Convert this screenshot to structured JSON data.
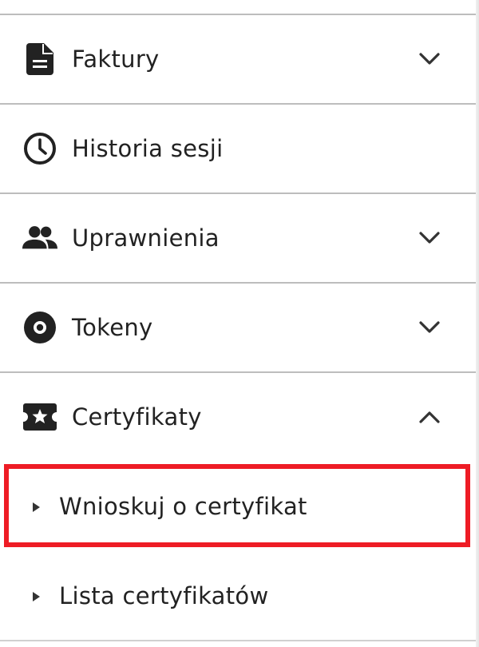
{
  "menu": {
    "items": [
      {
        "label": "Faktury",
        "icon": "document-icon",
        "chevron": "chevron-down-icon"
      },
      {
        "label": "Historia sesji",
        "icon": "clock-icon",
        "chevron": ""
      },
      {
        "label": "Uprawnienia",
        "icon": "people-icon",
        "chevron": "chevron-down-icon"
      },
      {
        "label": "Tokeny",
        "icon": "token-disc-icon",
        "chevron": "chevron-down-icon"
      },
      {
        "label": "Certyfikaty",
        "icon": "certificate-star-icon",
        "chevron": "chevron-up-icon"
      }
    ],
    "certyfikaty_submenu": [
      {
        "label": "Wnioskuj o certyfikat",
        "icon": "triangle-right-icon",
        "highlighted": true
      },
      {
        "label": "Lista certyfikatów",
        "icon": "triangle-right-icon",
        "highlighted": false
      }
    ]
  },
  "colors": {
    "text": "#222222",
    "divider": "#bdbdbd",
    "highlight_border": "#ee1c25"
  }
}
